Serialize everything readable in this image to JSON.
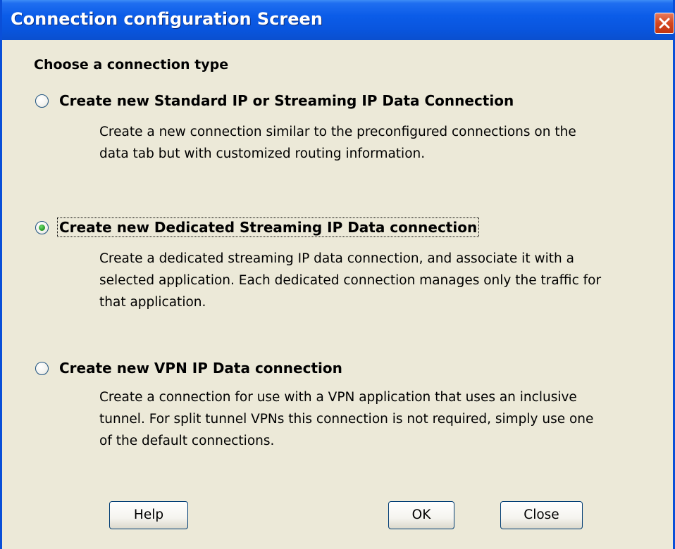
{
  "window": {
    "title": "Connection configuration Screen",
    "close_icon": "close-icon"
  },
  "heading": "Choose a connection type",
  "options": [
    {
      "label": "Create new Standard IP or Streaming IP Data Connection",
      "description": "Create a new connection similar to the preconfigured connections on the data tab but with customized routing information.",
      "selected": false
    },
    {
      "label": "Create new Dedicated Streaming IP Data connection",
      "description": "Create a dedicated streaming IP data connection, and associate it with a selected application. Each dedicated connection manages only the traffic for that application.",
      "selected": true
    },
    {
      "label": "Create new VPN IP Data connection",
      "description": "Create a connection for use with a VPN application that uses an inclusive tunnel. For split tunnel VPNs this connection is not required, simply use one of the default connections.",
      "selected": false
    }
  ],
  "buttons": {
    "help": "Help",
    "ok": "OK",
    "close": "Close"
  },
  "colors": {
    "titlebar": "#0b5ce8",
    "window_background": "#ece9d8",
    "radio_selected": "#2b9f2b",
    "close_button": "#d4461f"
  }
}
